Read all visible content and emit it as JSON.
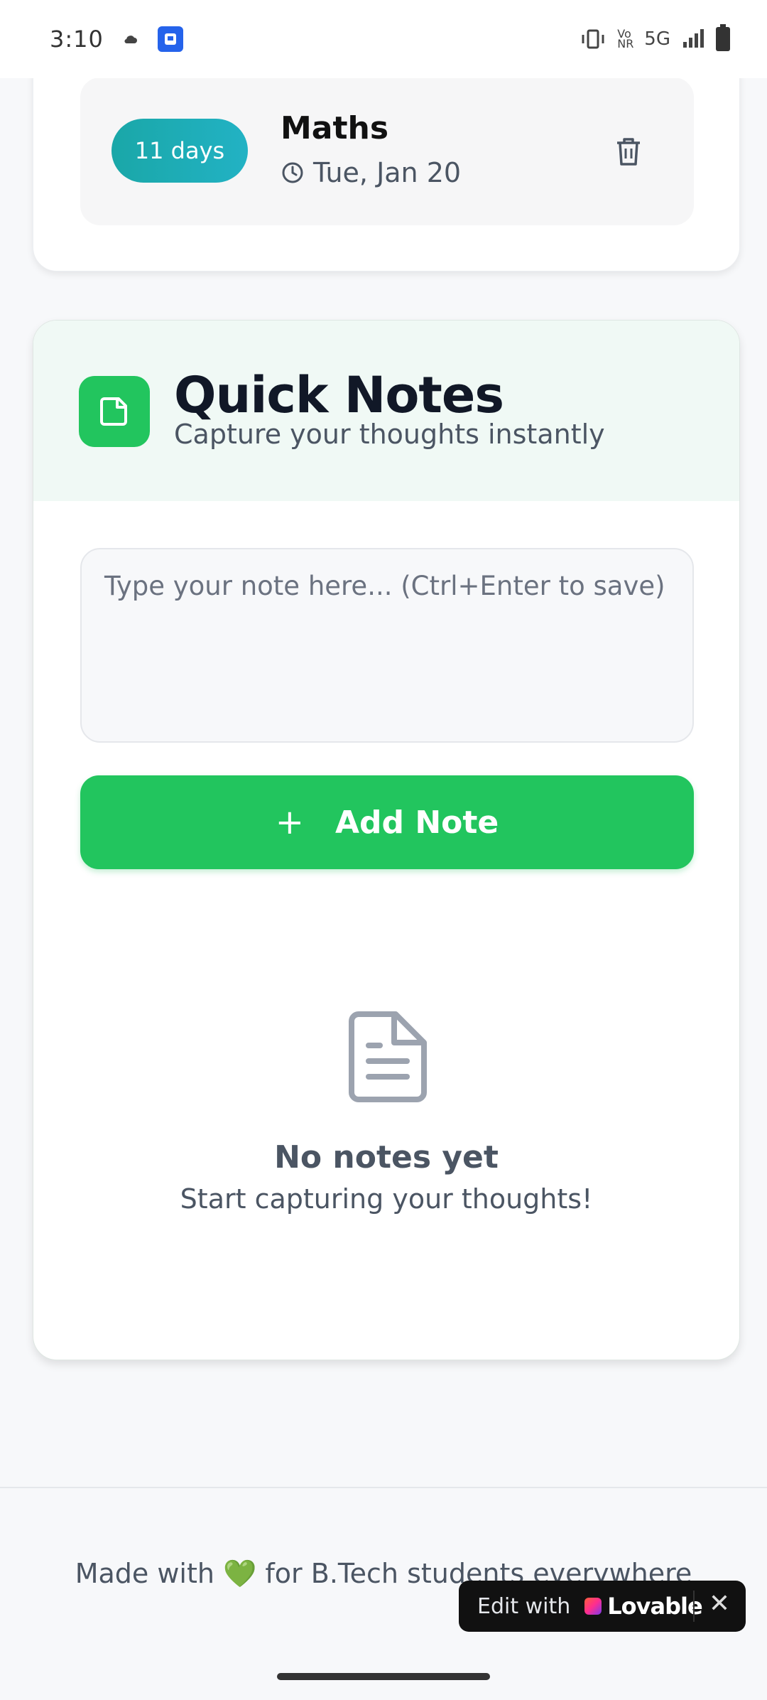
{
  "status_bar": {
    "time": "3:10",
    "network": "5G",
    "volte": "Vo NR",
    "icons": [
      "cloud-icon",
      "app-icon",
      "vibrate-icon",
      "signal-icon",
      "battery-icon"
    ]
  },
  "exam": {
    "days_left": "11 days",
    "subject": "Maths",
    "date": "Tue, Jan 20"
  },
  "notes": {
    "title": "Quick Notes",
    "subtitle": "Capture your thoughts instantly",
    "input_placeholder": "Type your note here... (Ctrl+Enter to save)",
    "input_value": "",
    "add_label": "Add Note",
    "add_plus": "+",
    "empty_title": "No notes yet",
    "empty_subtitle": "Start capturing your thoughts!"
  },
  "footer": {
    "text": "Made with 💚 for B.Tech students everywhere"
  },
  "badge": {
    "edit_label": "Edit with",
    "brand": "Lovable",
    "close": "✕"
  },
  "colors": {
    "accent": "#22c55e",
    "pill": "#1aa7a8",
    "header_bg": "#f0f9f5"
  }
}
